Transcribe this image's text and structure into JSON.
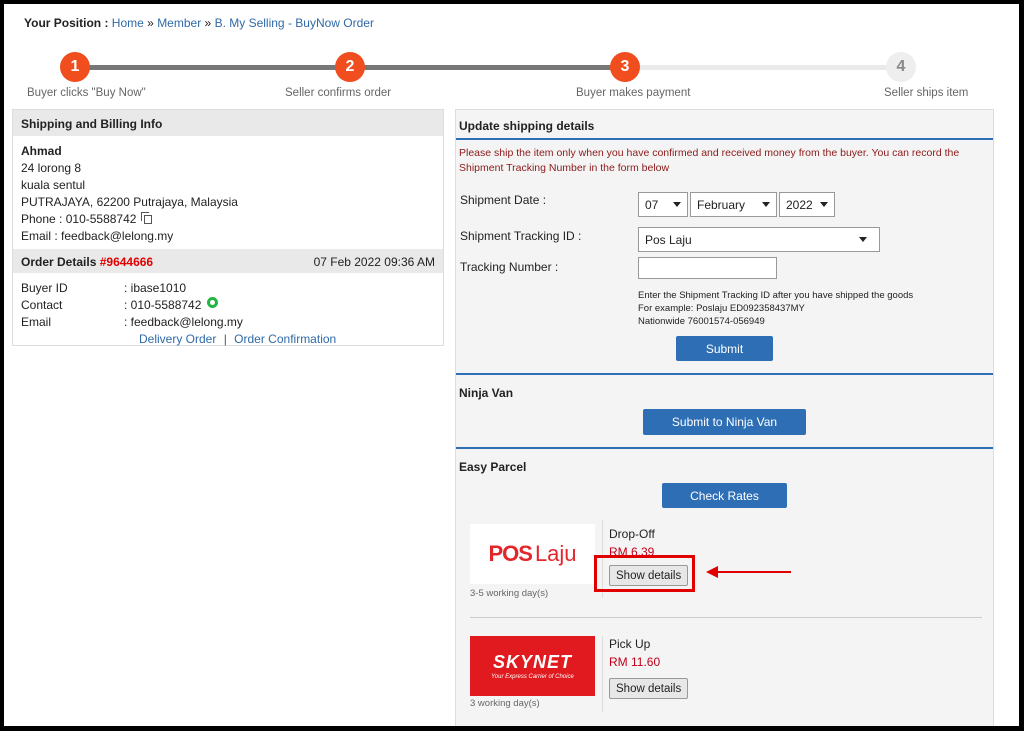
{
  "breadcrumb": {
    "label": "Your Position :",
    "home": "Home",
    "member": "Member",
    "current": "B. My Selling - BuyNow Order",
    "separator": "»"
  },
  "steps": [
    {
      "number": "1",
      "label": "Buyer clicks \"Buy Now\"",
      "state": "active"
    },
    {
      "number": "2",
      "label": "Seller confirms order",
      "state": "active"
    },
    {
      "number": "3",
      "label": "Buyer makes payment",
      "state": "active"
    },
    {
      "number": "4",
      "label": "Seller ships item",
      "state": "inactive"
    }
  ],
  "shipping_info": {
    "title": "Shipping and Billing Info",
    "name": "Ahmad",
    "address1": "24 lorong 8",
    "address2": "kuala sentul",
    "address3": "PUTRAJAYA, 62200 Putrajaya, Malaysia",
    "phone_label": "Phone :",
    "phone": "010-5588742",
    "email_label": "Email :",
    "email": "feedback@lelong.my"
  },
  "order_details": {
    "title": "Order Details",
    "order_no": "#9644666",
    "datetime": "07 Feb 2022 09:36 AM",
    "rows": [
      {
        "key": "Buyer ID",
        "value": ": ibase1010"
      },
      {
        "key": "Contact",
        "value": ": 010-5588742"
      },
      {
        "key": "Email",
        "value": ": feedback@lelong.my"
      }
    ],
    "link_delivery": "Delivery Order",
    "link_confirmation": "Order Confirmation",
    "link_sep": "|"
  },
  "update_shipping": {
    "title": "Update shipping details",
    "warning": "Please ship the item only when you have confirmed and received money from the buyer. You can record the Shipment Tracking Number in the form below",
    "shipment_date_label": "Shipment Date :",
    "day": "07",
    "month": "February",
    "year": "2022",
    "tracking_id_label": "Shipment Tracking ID :",
    "tracking_id_value": "Pos Laju",
    "tracking_number_label": "Tracking Number :",
    "tracking_number_value": "",
    "hint_line1": "Enter the Shipment Tracking ID after you have shipped the goods",
    "hint_line2": "For example: Poslaju ED092358437MY",
    "hint_line3": "Nationwide 76001574-056949",
    "submit_label": "Submit"
  },
  "ninja_van": {
    "title": "Ninja Van",
    "submit_label": "Submit to Ninja Van"
  },
  "easy_parcel": {
    "title": "Easy Parcel",
    "check_rates_label": "Check Rates",
    "couriers": [
      {
        "logo_text_a": "POS",
        "logo_text_b": "Laju",
        "service": "Drop-Off",
        "price": "RM 6.39",
        "days": "3-5 working day(s)",
        "details_label": "Show details"
      },
      {
        "logo_text_a": "SKYNET",
        "logo_text_b": "Your Express Carrier of Choice",
        "service": "Pick Up",
        "price": "RM 11.60",
        "days": "3 working day(s)",
        "details_label": "Show details"
      }
    ]
  },
  "colors": {
    "step_active": "#f04e1e",
    "primary_blue": "#2e6eb5",
    "link": "#2f6aa8",
    "order_no": "#e10000",
    "highlight": "#e00000"
  }
}
